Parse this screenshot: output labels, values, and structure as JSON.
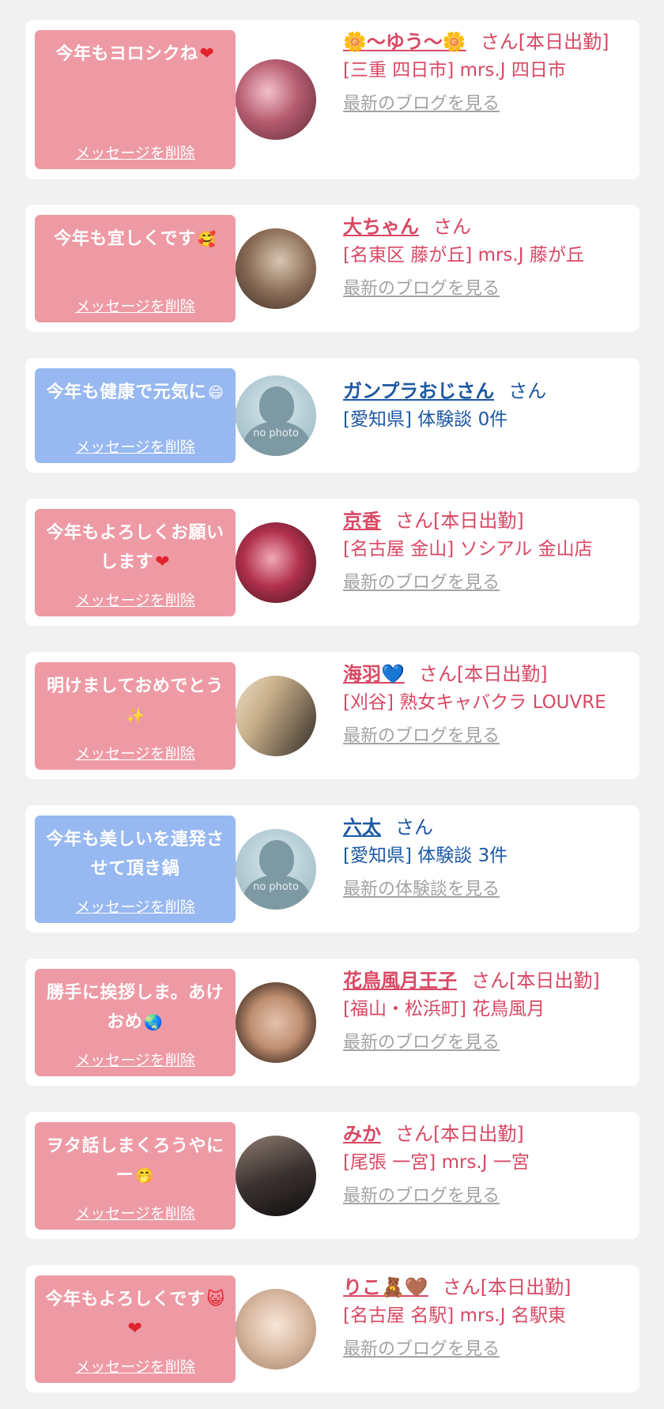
{
  "delete_label": "メッセージを削除",
  "cards": [
    {
      "color": "pink",
      "message": "今年もヨロシクね",
      "message_emoji": "❤",
      "name_prefix": "🌼",
      "name": "〜ゆう〜",
      "name_suffix_emoji": "🌼",
      "honorific": "さん[本日出勤]",
      "shop": "[三重 四日市] mrs.J 四日市",
      "link": "最新のブログを見る",
      "avatar": "photo"
    },
    {
      "color": "pink",
      "message": "今年も宜しくです",
      "message_emoji": "🥰",
      "name": "大ちゃん",
      "honorific": "さん",
      "shop": "[名東区 藤が丘] mrs.J 藤が丘",
      "link": "最新のブログを見る",
      "avatar": "photo"
    },
    {
      "color": "blue",
      "message": "今年も健康で元気に",
      "message_emoji": "😄",
      "name": "ガンプラおじさん",
      "honorific": "さん",
      "shop": "[愛知県] 体験談 0件",
      "link": "",
      "avatar": "no photo"
    },
    {
      "color": "pink",
      "message": "今年もよろしくお願いします",
      "message_emoji": "❤",
      "name": "京香",
      "honorific": "さん[本日出勤]",
      "shop": "[名古屋 金山] ソシアル 金山店",
      "link": "最新のブログを見る",
      "avatar": "photo"
    },
    {
      "color": "pink",
      "message": "明けましておめでとう",
      "message_emoji": "✨",
      "name": "海羽",
      "name_suffix_emoji": "💙",
      "honorific": "さん[本日出勤]",
      "shop": "[刈谷] 熟女キャバクラ LOUVRE",
      "link": "最新のブログを見る",
      "avatar": "photo"
    },
    {
      "color": "blue",
      "message": "今年も美しいを連発させて頂き鍋",
      "message_emoji": "",
      "name": "六太",
      "honorific": "さん",
      "shop": "[愛知県] 体験談 3件",
      "link": "最新の体験談を見る",
      "avatar": "no photo"
    },
    {
      "color": "pink",
      "message": "勝手に挨拶しま。あけおめ",
      "message_emoji": "🌏",
      "name": "花鳥風月王子",
      "honorific": "さん[本日出勤]",
      "shop": "[福山・松浜町] 花鳥風月",
      "link": "最新のブログを見る",
      "avatar": "photo"
    },
    {
      "color": "pink",
      "message": "ヲタ話しまくろうやにー",
      "message_emoji": "🤭",
      "name": "みか",
      "honorific": "さん[本日出勤]",
      "shop": "[尾張 一宮] mrs.J 一宮",
      "link": "最新のブログを見る",
      "avatar": "photo"
    },
    {
      "color": "pink",
      "message": "今年もよろしくです",
      "message_emoji": "😺❤",
      "name": "りこ",
      "name_suffix_emoji": "🧸🤎",
      "honorific": "さん[本日出勤]",
      "shop": "[名古屋 名駅] mrs.J 名駅東",
      "link": "最新のブログを見る",
      "avatar": "photo"
    }
  ]
}
